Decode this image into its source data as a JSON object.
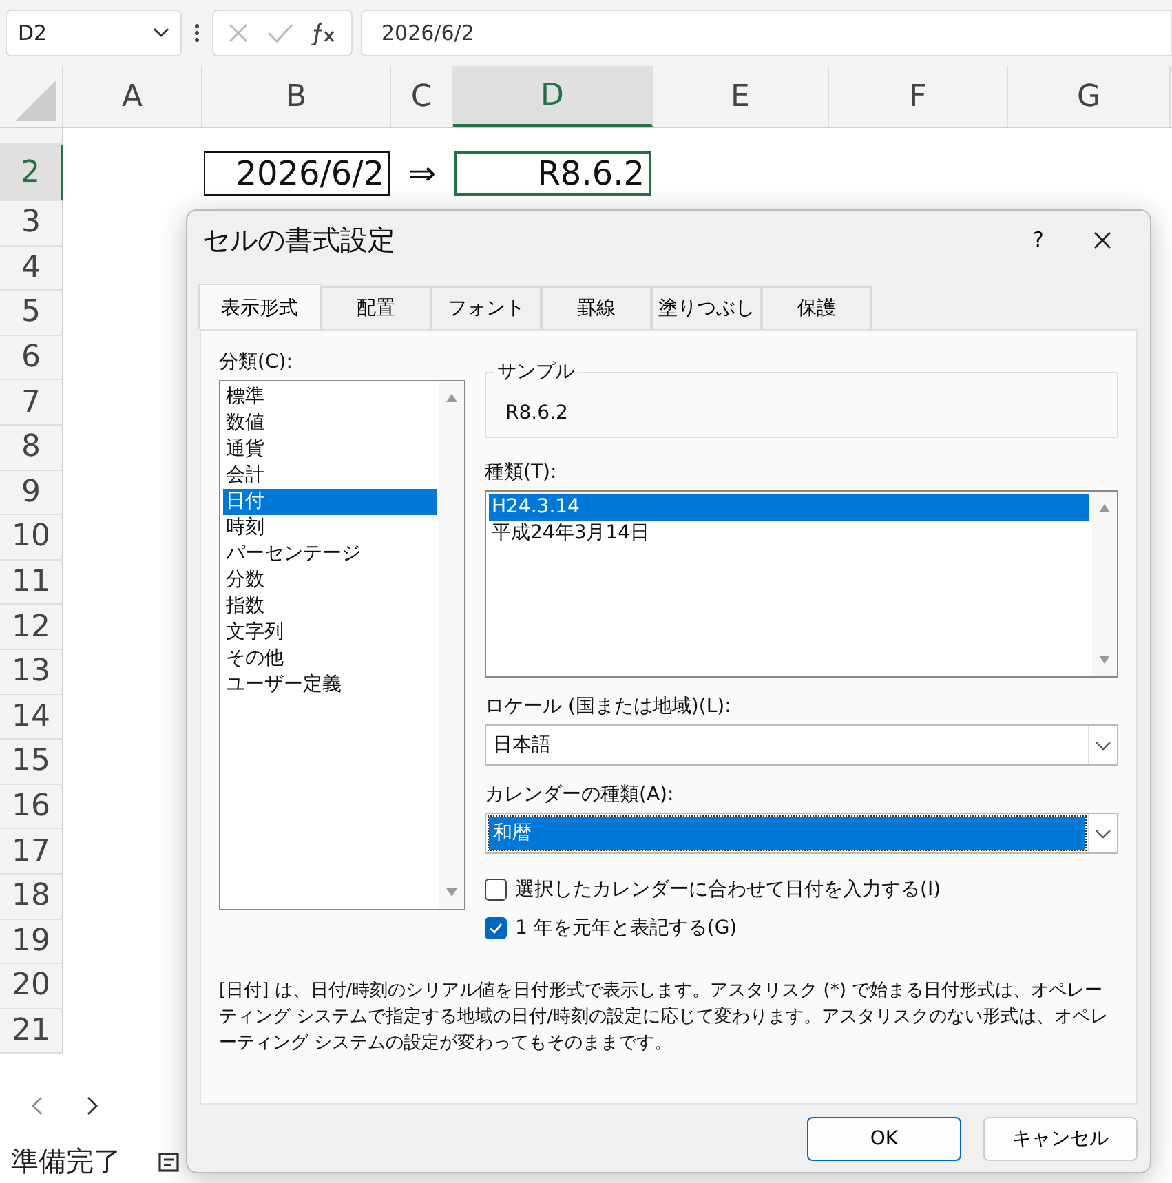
{
  "name_box": {
    "value": "D2"
  },
  "formula_bar": {
    "value": "2026/6/2"
  },
  "columns": [
    {
      "label": "A",
      "selected": false
    },
    {
      "label": "B",
      "selected": false
    },
    {
      "label": "C",
      "selected": false
    },
    {
      "label": "D",
      "selected": true
    },
    {
      "label": "E",
      "selected": false
    },
    {
      "label": "F",
      "selected": false
    },
    {
      "label": "G",
      "selected": false
    }
  ],
  "rows": [
    {
      "label": "2",
      "selected": true,
      "cells": [
        {},
        {
          "value": "2026/6/2",
          "border": true,
          "selected": false
        },
        {
          "value": "⇒",
          "border": false,
          "selected": false
        },
        {
          "value": "R8.6.2",
          "border": false,
          "selected": true
        }
      ]
    },
    {
      "label": "3",
      "selected": false
    },
    {
      "label": "4",
      "selected": false
    },
    {
      "label": "5",
      "selected": false
    },
    {
      "label": "6",
      "selected": false
    },
    {
      "label": "7",
      "selected": false
    },
    {
      "label": "8",
      "selected": false
    },
    {
      "label": "9",
      "selected": false
    },
    {
      "label": "10",
      "selected": false
    },
    {
      "label": "11",
      "selected": false
    },
    {
      "label": "12",
      "selected": false
    },
    {
      "label": "13",
      "selected": false
    },
    {
      "label": "14",
      "selected": false
    },
    {
      "label": "15",
      "selected": false
    },
    {
      "label": "16",
      "selected": false
    },
    {
      "label": "17",
      "selected": false
    },
    {
      "label": "18",
      "selected": false
    },
    {
      "label": "19",
      "selected": false
    },
    {
      "label": "20",
      "selected": false
    },
    {
      "label": "21",
      "selected": false
    }
  ],
  "status_bar": {
    "text": "準備完了"
  },
  "dialog": {
    "title": "セルの書式設定",
    "help": "?",
    "tabs": [
      {
        "label": "表示形式",
        "selected": true
      },
      {
        "label": "配置",
        "selected": false
      },
      {
        "label": "フォント",
        "selected": false
      },
      {
        "label": "罫線",
        "selected": false
      },
      {
        "label": "塗りつぶし",
        "selected": false
      },
      {
        "label": "保護",
        "selected": false
      }
    ],
    "category": {
      "label": "分類(C):",
      "items": [
        {
          "label": "標準",
          "selected": false
        },
        {
          "label": "数値",
          "selected": false
        },
        {
          "label": "通貨",
          "selected": false
        },
        {
          "label": "会計",
          "selected": false
        },
        {
          "label": "日付",
          "selected": true
        },
        {
          "label": "時刻",
          "selected": false
        },
        {
          "label": "パーセンテージ",
          "selected": false
        },
        {
          "label": "分数",
          "selected": false
        },
        {
          "label": "指数",
          "selected": false
        },
        {
          "label": "文字列",
          "selected": false
        },
        {
          "label": "その他",
          "selected": false
        },
        {
          "label": "ユーザー定義",
          "selected": false
        }
      ]
    },
    "sample": {
      "label": "サンプル",
      "value": "R8.6.2"
    },
    "type": {
      "label": "種類(T):",
      "items": [
        {
          "label": "H24.3.14",
          "selected": true
        },
        {
          "label": "平成24年3月14日",
          "selected": false
        }
      ]
    },
    "locale": {
      "label": "ロケール (国または地域)(L):",
      "value": "日本語",
      "focused": false
    },
    "calendar": {
      "label": "カレンダーの種類(A):",
      "value": "和暦",
      "focused": true
    },
    "options": [
      {
        "label": "選択したカレンダーに合わせて日付を入力する(I)",
        "checked": false
      },
      {
        "label": "1 年を元年と表記する(G)",
        "checked": true
      }
    ],
    "description": "[日付] は、日付/時刻のシリアル値を日付形式で表示します。アスタリスク (*) で始まる日付形式は、オペレーティング システムで指定する地域の日付/時刻の設定に応じて変わります。アスタリスクのない形式は、オペレーティング システムの設定が変わってもそのままです。",
    "buttons": [
      {
        "label": "OK",
        "default": true
      },
      {
        "label": "キャンセル",
        "default": false
      }
    ]
  }
}
